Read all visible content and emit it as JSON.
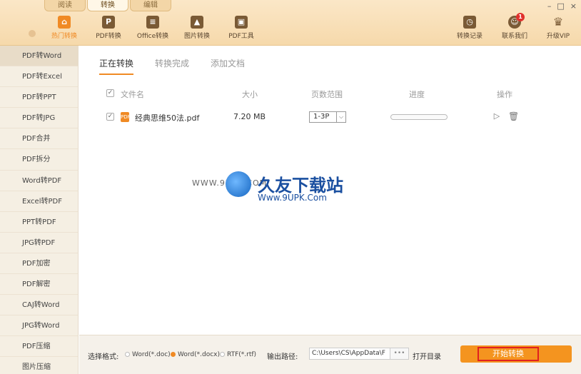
{
  "window": {
    "tabs": [
      "阅读",
      "转换",
      "编辑"
    ],
    "active_tab": 1,
    "controls": [
      "–",
      "□",
      "×"
    ]
  },
  "toolbar": {
    "left_tools": [
      {
        "label": "热门转换",
        "icon": "home-icon"
      },
      {
        "label": "PDF转换",
        "icon": "pdf-icon"
      },
      {
        "label": "Office转换",
        "icon": "document-icon"
      },
      {
        "label": "图片转换",
        "icon": "image-icon"
      },
      {
        "label": "PDF工具",
        "icon": "toolbox-icon"
      }
    ],
    "right_tools": [
      {
        "label": "转换记录",
        "icon": "clock-icon"
      },
      {
        "label": "联系我们",
        "icon": "support-icon",
        "badge": "1"
      },
      {
        "label": "升级VIP",
        "icon": "crown-icon"
      }
    ]
  },
  "sidebar": {
    "items": [
      "PDF转Word",
      "PDF转Excel",
      "PDF转PPT",
      "PDF转JPG",
      "PDF合并",
      "PDF拆分",
      "Word转PDF",
      "Excel转PDF",
      "PPT转PDF",
      "JPG转PDF",
      "PDF加密",
      "PDF解密",
      "CAJ转Word",
      "JPG转Word",
      "PDF压缩",
      "图片压缩"
    ],
    "active": 0
  },
  "subtabs": {
    "items": [
      "正在转换",
      "转换完成",
      "添加文档"
    ],
    "active": 0
  },
  "table": {
    "headers": {
      "name": "文件名",
      "size": "大小",
      "pages": "页数范围",
      "progress": "进度",
      "ops": "操作"
    },
    "rows": [
      {
        "name": "经典思维50法.pdf",
        "size": "7.20 MB",
        "pages": "1-3P",
        "progress": 0
      }
    ]
  },
  "watermark": {
    "small": "WWW.9UPK.COM",
    "title": "久友下载站",
    "url": "Www.9UPK.Com"
  },
  "bottom": {
    "format_label": "选择格式:",
    "formats": [
      "Word(*.doc)",
      "Word(*.docx)",
      "RTF(*.rtf)"
    ],
    "selected_format": 1,
    "output_label": "输出路径:",
    "output_path": "C:\\Users\\CS\\AppData\\F",
    "more": "•••",
    "open_dir": "打开目录",
    "start": "开始转换"
  }
}
